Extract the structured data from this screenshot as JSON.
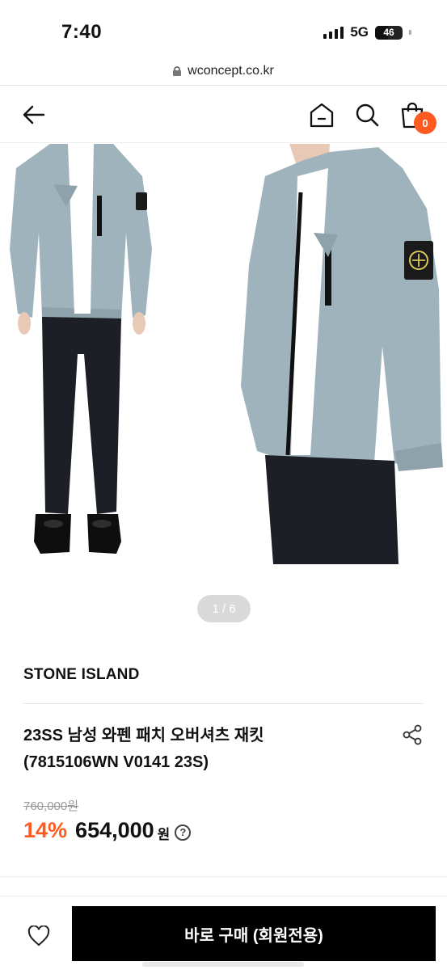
{
  "status_bar": {
    "time": "7:40",
    "network": "5G",
    "battery_percent": 46,
    "battery_text": "46"
  },
  "url_bar": {
    "url": "wconcept.co.kr",
    "icon": "lock-icon"
  },
  "header": {
    "icons": [
      "back-arrow-icon",
      "home-icon",
      "search-icon",
      "shopping-bag-icon"
    ],
    "cart_count": "0"
  },
  "gallery": {
    "pager_text": "1 / 6",
    "current": 1,
    "total": 6
  },
  "product": {
    "brand": "STONE ISLAND",
    "title_line1": "23SS 남성 와펜 패치 오버셔츠 재킷",
    "title_line2": "(7815106WN V0141 23S)",
    "original_price": "760,000원",
    "discount": "14%",
    "price": "654,000",
    "currency": "원",
    "help": "?"
  },
  "bottom_bar": {
    "buy_label": "바로 구매 (회원전용)",
    "wish_icon": "heart-icon"
  },
  "colors": {
    "accent": "#ff5a1f",
    "button": "#000000",
    "jacket": "#9fb3bd"
  }
}
